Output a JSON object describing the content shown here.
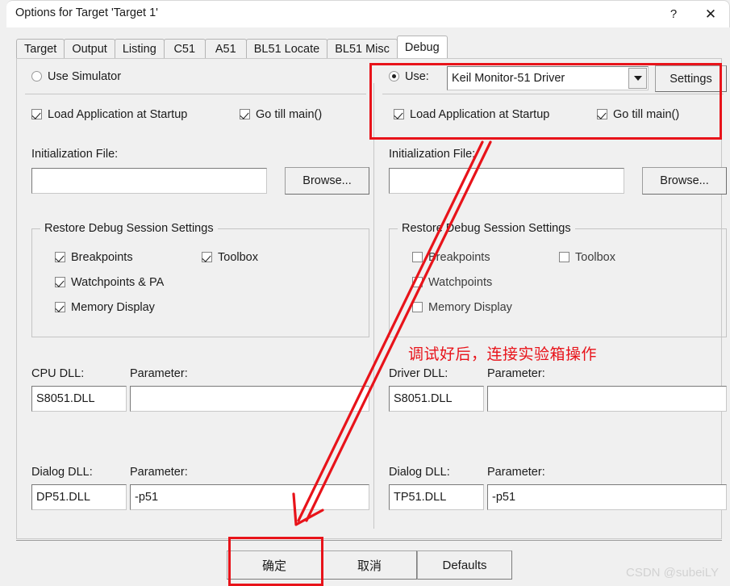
{
  "window": {
    "title": "Options for Target 'Target 1'",
    "help_glyph": "?",
    "close_glyph": "✕"
  },
  "tabs": [
    {
      "label": "Target",
      "active": false
    },
    {
      "label": "Output",
      "active": false
    },
    {
      "label": "Listing",
      "active": false
    },
    {
      "label": "C51",
      "active": false
    },
    {
      "label": "A51",
      "active": false
    },
    {
      "label": "BL51 Locate",
      "active": false
    },
    {
      "label": "BL51 Misc",
      "active": false
    },
    {
      "label": "Debug",
      "active": true
    }
  ],
  "left_panel": {
    "mode_radio": {
      "label": "Use Simulator",
      "checked": false
    },
    "load_app": {
      "label": "Load Application at Startup",
      "checked": true
    },
    "go_till_main": {
      "label": "Go  till main()",
      "checked": true
    },
    "init_file_label": "Initialization File:",
    "init_file_value": "",
    "init_file_placeholder": "",
    "browse_label": "Browse...",
    "group_title": "Restore Debug Session Settings",
    "group_items": [
      {
        "label": "Breakpoints",
        "checked": true
      },
      {
        "label": "Toolbox",
        "checked": true
      },
      {
        "label": "Watchpoints & PA",
        "checked": true
      },
      {
        "label": "Memory Display",
        "checked": true
      }
    ],
    "dll_label": "CPU DLL:",
    "dll_value": "S8051.DLL",
    "dll_param_label": "Parameter:",
    "dll_param_value": "",
    "dialog_dll_label": "Dialog DLL:",
    "dialog_dll_value": "DP51.DLL",
    "dialog_param_label": "Parameter:",
    "dialog_param_value": "-p51"
  },
  "right_panel": {
    "mode_radio": {
      "label": "Use:",
      "checked": true
    },
    "driver_value": "Keil Monitor-51 Driver",
    "settings_label": "Settings",
    "load_app": {
      "label": "Load Application at Startup",
      "checked": true
    },
    "go_till_main": {
      "label": "Go  till main()",
      "checked": true
    },
    "init_file_label": "Initialization File:",
    "init_file_value": "",
    "init_file_placeholder": "",
    "browse_label": "Browse...",
    "group_title": "Restore Debug Session Settings",
    "group_items": [
      {
        "label": "Breakpoints",
        "checked": false
      },
      {
        "label": "Toolbox",
        "checked": false
      },
      {
        "label": "Watchpoints",
        "checked": false
      },
      {
        "label": "Memory Display",
        "checked": false
      }
    ],
    "dll_label": "Driver DLL:",
    "dll_value": "S8051.DLL",
    "dll_param_label": "Parameter:",
    "dll_param_value": "",
    "dialog_dll_label": "Dialog DLL:",
    "dialog_dll_value": "TP51.DLL",
    "dialog_param_label": "Parameter:",
    "dialog_param_value": "-p51"
  },
  "footer": {
    "ok_label": "确定",
    "cancel_label": "取消",
    "defaults_label": "Defaults"
  },
  "annotations": {
    "note_text": "调试好后，连接实验箱操作",
    "accent_color": "#e8131a",
    "watermark": "CSDN @subeiLY"
  }
}
